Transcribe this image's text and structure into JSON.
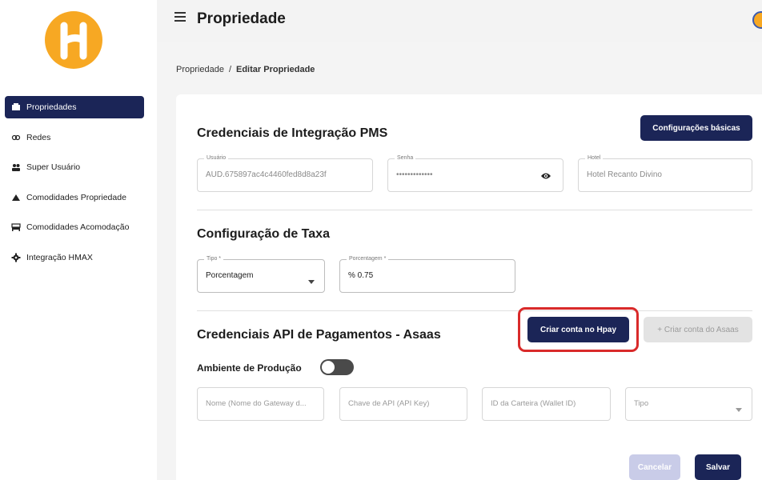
{
  "header": {
    "title": "Propriedade"
  },
  "breadcrumb": {
    "root": "Propriedade",
    "separator": "/",
    "current": "Editar Propriedade"
  },
  "sidebar": {
    "items": [
      {
        "label": "Propriedades",
        "icon": "building-icon",
        "active": true
      },
      {
        "label": "Redes",
        "icon": "link-icon",
        "active": false
      },
      {
        "label": "Super Usuário",
        "icon": "users-icon",
        "active": false
      },
      {
        "label": "Comodidades Propriedade",
        "icon": "triangle-icon",
        "active": false
      },
      {
        "label": "Comodidades Acomodação",
        "icon": "bed-icon",
        "active": false
      },
      {
        "label": "Integração HMAX",
        "icon": "gear-icon",
        "active": false
      }
    ]
  },
  "pms": {
    "title": "Credenciais de Integração PMS",
    "config_button": "Configurações básicas",
    "user": {
      "label": "Usuário",
      "value": "AUD.675897ac4c4460fed8d8a23f"
    },
    "password": {
      "label": "Senha",
      "value": "•••••••••••••"
    },
    "hotel": {
      "label": "Hotel",
      "value": "Hotel Recanto Divino"
    }
  },
  "tax": {
    "title": "Configuração de Taxa",
    "type": {
      "label": "Tipo *",
      "value": "Porcentagem"
    },
    "percent": {
      "label": "Porcentagem *",
      "value": "% 0.75"
    }
  },
  "payments": {
    "title": "Credenciais API de Pagamentos - Asaas",
    "create_hpay_button": "Criar conta no Hpay",
    "create_asaas_button": "+ Criar conta do Asaas",
    "production_label": "Ambiente de Produção",
    "production_enabled": false,
    "fields": {
      "name": "Nome (Nome do Gateway d...",
      "api_key": "Chave de API (API Key)",
      "wallet": "ID da Carteira (Wallet ID)",
      "type": "Tipo"
    }
  },
  "actions": {
    "cancel": "Cancelar",
    "save": "Salvar"
  },
  "colors": {
    "brand": "#f7a823",
    "primary": "#1b2557",
    "highlight": "#d92a2a"
  }
}
